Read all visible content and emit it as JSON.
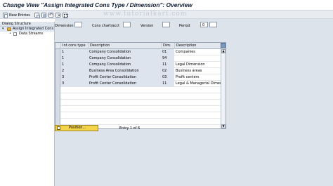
{
  "window": {
    "title": "Change View \"Assign Integrated Cons Type / Dimension\": Overview"
  },
  "toolbar": {
    "new_entries": "New Entries",
    "icons": [
      "copy-icon",
      "save-icon",
      "undo-icon",
      "delete-icon",
      "select-all-icon"
    ]
  },
  "watermark": "www.tutorialkart.com",
  "sidebar": {
    "header": "Dialog Structure",
    "items": [
      {
        "label": "Assign Integrated Cons",
        "level": 0,
        "selected": true,
        "expanded": true
      },
      {
        "label": "Data Streams",
        "level": 1,
        "selected": false
      }
    ]
  },
  "filters": {
    "dimension_label": "Dimension",
    "dimension_value": "",
    "cons_chart_label": "Cons chart/acct",
    "cons_chart_value": "",
    "version_label": "Version",
    "version_value": "",
    "period_label": "Period",
    "period_value": "0",
    "period_value2": ""
  },
  "table": {
    "columns": [
      "Int.cons type",
      "Description",
      "Dim.",
      "Description"
    ],
    "rows": [
      [
        "1",
        "Company Consolidation",
        "01",
        "Companies"
      ],
      [
        "1",
        "Company Consolidation",
        "94",
        ""
      ],
      [
        "1",
        "Company Consolidation",
        "11",
        "Legal Dimension"
      ],
      [
        "2",
        "Business Area Consolidation",
        "02",
        "Business areas"
      ],
      [
        "3",
        "Profit Center Consolidation",
        "03",
        "Profit centers"
      ],
      [
        "3",
        "Profit Center Consolidation",
        "11",
        "Legal & Managerial Dimensi"
      ],
      [
        "",
        "",
        "",
        ""
      ],
      [
        "",
        "",
        "",
        ""
      ],
      [
        "",
        "",
        "",
        ""
      ],
      [
        "",
        "",
        "",
        ""
      ],
      [
        "",
        "",
        "",
        ""
      ],
      [
        "",
        "",
        "",
        ""
      ]
    ]
  },
  "footer": {
    "position_button": "Position...",
    "entry_status": "Entry 1 of 6"
  },
  "colors": {
    "toolbar_bg": "#e8ebf0",
    "main_bg": "#dde3ea",
    "button_yellow": "#f3d34a",
    "title_text": "#0b1a33"
  }
}
